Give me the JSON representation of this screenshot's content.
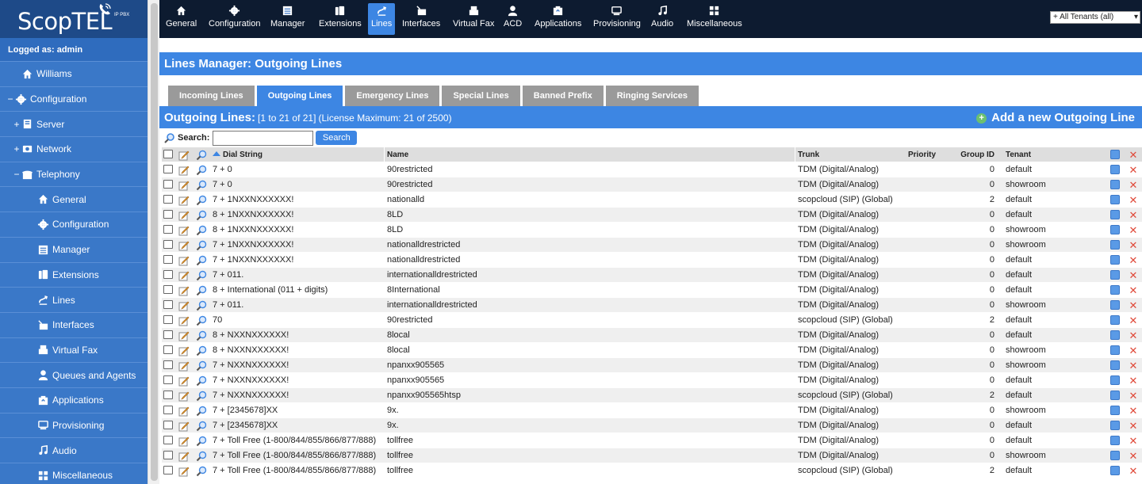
{
  "app": {
    "brand": "ScopTEL",
    "brand_sub": "IP PBX",
    "logged_as": "Logged as: admin"
  },
  "sidebar": {
    "items": [
      {
        "label": "Williams",
        "level": 1,
        "toggle": "",
        "icon": "home-icon"
      },
      {
        "label": "Configuration",
        "level": 0,
        "toggle": "−",
        "icon": "gear-icon"
      },
      {
        "label": "Server",
        "level": 1,
        "toggle": "+",
        "icon": "server-icon"
      },
      {
        "label": "Network",
        "level": 1,
        "toggle": "+",
        "icon": "network-icon"
      },
      {
        "label": "Telephony",
        "level": 1,
        "toggle": "−",
        "icon": "telephony-icon"
      },
      {
        "label": "General",
        "level": 2,
        "toggle": "",
        "icon": "home-icon"
      },
      {
        "label": "Configuration",
        "level": 2,
        "toggle": "",
        "icon": "gear-icon"
      },
      {
        "label": "Manager",
        "level": 2,
        "toggle": "",
        "icon": "manager-icon"
      },
      {
        "label": "Extensions",
        "level": 2,
        "toggle": "",
        "icon": "extensions-icon"
      },
      {
        "label": "Lines",
        "level": 2,
        "toggle": "",
        "icon": "lines-icon"
      },
      {
        "label": "Interfaces",
        "level": 2,
        "toggle": "",
        "icon": "interfaces-icon"
      },
      {
        "label": "Virtual Fax",
        "level": 2,
        "toggle": "",
        "icon": "fax-icon"
      },
      {
        "label": "Queues and Agents",
        "level": 2,
        "toggle": "",
        "icon": "agent-icon"
      },
      {
        "label": "Applications",
        "level": 2,
        "toggle": "",
        "icon": "applications-icon"
      },
      {
        "label": "Provisioning",
        "level": 2,
        "toggle": "",
        "icon": "provisioning-icon"
      },
      {
        "label": "Audio",
        "level": 2,
        "toggle": "",
        "icon": "music-icon"
      },
      {
        "label": "Miscellaneous",
        "level": 2,
        "toggle": "",
        "icon": "misc-icon"
      }
    ]
  },
  "topnav": {
    "items": [
      {
        "label": "General",
        "icon": "home-icon",
        "active": false
      },
      {
        "label": "Configuration",
        "icon": "gear-icon",
        "active": false
      },
      {
        "label": "Manager",
        "icon": "manager-icon",
        "active": false
      },
      {
        "label": "Extensions",
        "icon": "extensions-icon",
        "active": false
      },
      {
        "label": "Lines",
        "icon": "lines-icon",
        "active": true
      },
      {
        "label": "Interfaces",
        "icon": "interfaces-icon",
        "active": false
      },
      {
        "label": "Virtual Fax",
        "icon": "fax-icon",
        "active": false
      },
      {
        "label": "ACD",
        "icon": "agent-icon",
        "active": false
      },
      {
        "label": "Applications",
        "icon": "applications-icon",
        "active": false
      },
      {
        "label": "Provisioning",
        "icon": "provisioning-icon",
        "active": false
      },
      {
        "label": "Audio",
        "icon": "music-icon",
        "active": false
      },
      {
        "label": "Miscellaneous",
        "icon": "misc-icon",
        "active": false
      }
    ],
    "tenant_select": "+ All Tenants (all)"
  },
  "page": {
    "title": "Lines Manager:  Outgoing Lines",
    "tabs": [
      {
        "label": "Incoming Lines",
        "active": false
      },
      {
        "label": "Outgoing Lines",
        "active": true
      },
      {
        "label": "Emergency Lines",
        "active": false
      },
      {
        "label": "Special Lines",
        "active": false
      },
      {
        "label": "Banned Prefix",
        "active": false
      },
      {
        "label": "Ringing Services",
        "active": false
      }
    ],
    "subtitle": "Outgoing Lines:",
    "range": "[1 to 21 of 21]",
    "license": "(License Maximum: 21 of 2500)",
    "add_new": "Add a new Outgoing Line",
    "search_label": "Search:",
    "search_value": "",
    "search_button": "Search"
  },
  "table": {
    "columns": {
      "dial": "Dial String",
      "name": "Name",
      "trunk": "Trunk",
      "priority": "Priority",
      "group": "Group ID",
      "tenant": "Tenant"
    },
    "rows": [
      {
        "dial": "7 + 0",
        "name": "90restricted",
        "trunk": "TDM (Digital/Analog)",
        "priority": "",
        "group": "0",
        "tenant": "default"
      },
      {
        "dial": "7 + 0",
        "name": "90restricted",
        "trunk": "TDM (Digital/Analog)",
        "priority": "",
        "group": "0",
        "tenant": "showroom"
      },
      {
        "dial": "7 + 1NXXNXXXXXX!",
        "name": "nationalld",
        "trunk": "scopcloud (SIP) (Global)",
        "priority": "",
        "group": "2",
        "tenant": "default"
      },
      {
        "dial": "8 + 1NXXNXXXXXX!",
        "name": "8LD",
        "trunk": "TDM (Digital/Analog)",
        "priority": "",
        "group": "0",
        "tenant": "default"
      },
      {
        "dial": "8 + 1NXXNXXXXXX!",
        "name": "8LD",
        "trunk": "TDM (Digital/Analog)",
        "priority": "",
        "group": "0",
        "tenant": "showroom"
      },
      {
        "dial": "7 + 1NXXNXXXXXX!",
        "name": "nationalldrestricted",
        "trunk": "TDM (Digital/Analog)",
        "priority": "",
        "group": "0",
        "tenant": "showroom"
      },
      {
        "dial": "7 + 1NXXNXXXXXX!",
        "name": "nationalldrestricted",
        "trunk": "TDM (Digital/Analog)",
        "priority": "",
        "group": "0",
        "tenant": "default"
      },
      {
        "dial": "7 + 011.",
        "name": "internationalldrestricted",
        "trunk": "TDM (Digital/Analog)",
        "priority": "",
        "group": "0",
        "tenant": "default"
      },
      {
        "dial": "8 + International (011 + digits)",
        "name": "8International",
        "trunk": "TDM (Digital/Analog)",
        "priority": "",
        "group": "0",
        "tenant": "default"
      },
      {
        "dial": "7 + 011.",
        "name": "internationalldrestricted",
        "trunk": "TDM (Digital/Analog)",
        "priority": "",
        "group": "0",
        "tenant": "showroom"
      },
      {
        "dial": "70",
        "name": "90restricted",
        "trunk": "scopcloud (SIP) (Global)",
        "priority": "",
        "group": "2",
        "tenant": "default"
      },
      {
        "dial": "8 + NXXNXXXXXX!",
        "name": "8local",
        "trunk": "TDM (Digital/Analog)",
        "priority": "",
        "group": "0",
        "tenant": "default"
      },
      {
        "dial": "8 + NXXNXXXXXX!",
        "name": "8local",
        "trunk": "TDM (Digital/Analog)",
        "priority": "",
        "group": "0",
        "tenant": "showroom"
      },
      {
        "dial": "7 + NXXNXXXXXX!",
        "name": "npanxx905565",
        "trunk": "TDM (Digital/Analog)",
        "priority": "",
        "group": "0",
        "tenant": "showroom"
      },
      {
        "dial": "7 + NXXNXXXXXX!",
        "name": "npanxx905565",
        "trunk": "TDM (Digital/Analog)",
        "priority": "",
        "group": "0",
        "tenant": "default"
      },
      {
        "dial": "7 + NXXNXXXXXX!",
        "name": "npanxx905565htsp",
        "trunk": "scopcloud (SIP) (Global)",
        "priority": "",
        "group": "2",
        "tenant": "default"
      },
      {
        "dial": "7 + [2345678]XX",
        "name": "9x.",
        "trunk": "TDM (Digital/Analog)",
        "priority": "",
        "group": "0",
        "tenant": "showroom"
      },
      {
        "dial": "7 + [2345678]XX",
        "name": "9x.",
        "trunk": "TDM (Digital/Analog)",
        "priority": "",
        "group": "0",
        "tenant": "default"
      },
      {
        "dial": "7 + Toll Free (1-800/844/855/866/877/888)",
        "name": "tollfree",
        "trunk": "TDM (Digital/Analog)",
        "priority": "",
        "group": "0",
        "tenant": "default"
      },
      {
        "dial": "7 + Toll Free (1-800/844/855/866/877/888)",
        "name": "tollfree",
        "trunk": "TDM (Digital/Analog)",
        "priority": "",
        "group": "0",
        "tenant": "showroom"
      },
      {
        "dial": "7 + Toll Free (1-800/844/855/866/877/888)",
        "name": "tollfree",
        "trunk": "scopcloud (SIP) (Global)",
        "priority": "",
        "group": "2",
        "tenant": "default"
      }
    ]
  },
  "colors": {
    "accent": "#3d86e3",
    "sidebar": "#3a78c8",
    "topbar": "#0d1b30",
    "tab_inactive": "#9a9a9a",
    "delete": "#e04a3a"
  }
}
